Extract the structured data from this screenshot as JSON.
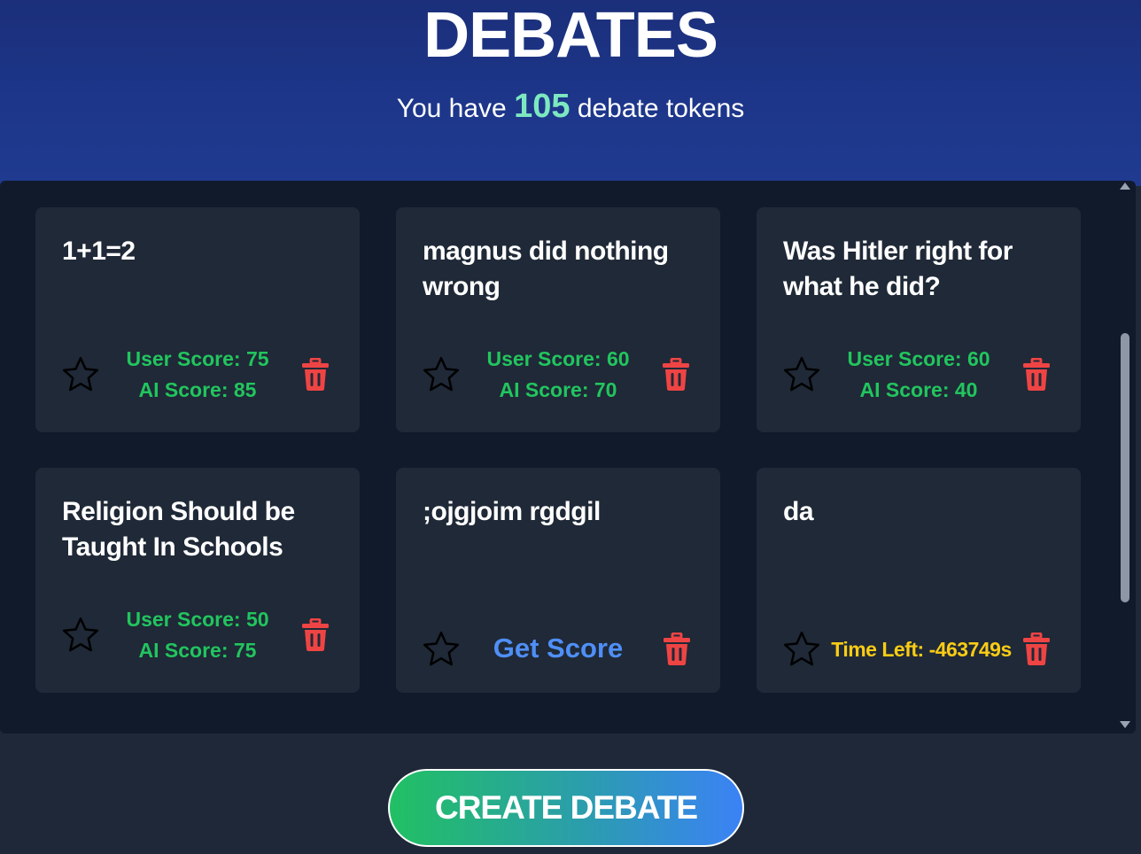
{
  "header": {
    "title": "DEBATES",
    "tokens_prefix": "You have",
    "tokens_count": "105",
    "tokens_suffix": "debate tokens"
  },
  "debates": [
    {
      "title": "1+1=2",
      "user_score": "User Score: 75",
      "ai_score": "AI Score: 85"
    },
    {
      "title": "magnus did nothing wrong",
      "user_score": "User Score: 60",
      "ai_score": "AI Score: 70"
    },
    {
      "title": "Was Hitler right for what he did?",
      "user_score": "User Score: 60",
      "ai_score": "AI Score: 40"
    },
    {
      "title": "Religion Should be Taught In Schools",
      "user_score": "User Score: 50",
      "ai_score": "AI Score: 75"
    },
    {
      "title": ";ojgjoim rgdgil",
      "action_label": "Get Score"
    },
    {
      "title": "da",
      "time_left": "Time Left: -463749s"
    }
  ],
  "icons": {
    "favorite": "star-outline-icon",
    "delete": "trash-icon"
  },
  "colors": {
    "score": "#22c55e",
    "get_score": "#4f8ff7",
    "time_left": "#facc15",
    "delete": "#ef4444",
    "tokens": "#7de8c0"
  },
  "footer": {
    "create_label": "CREATE DEBATE"
  }
}
